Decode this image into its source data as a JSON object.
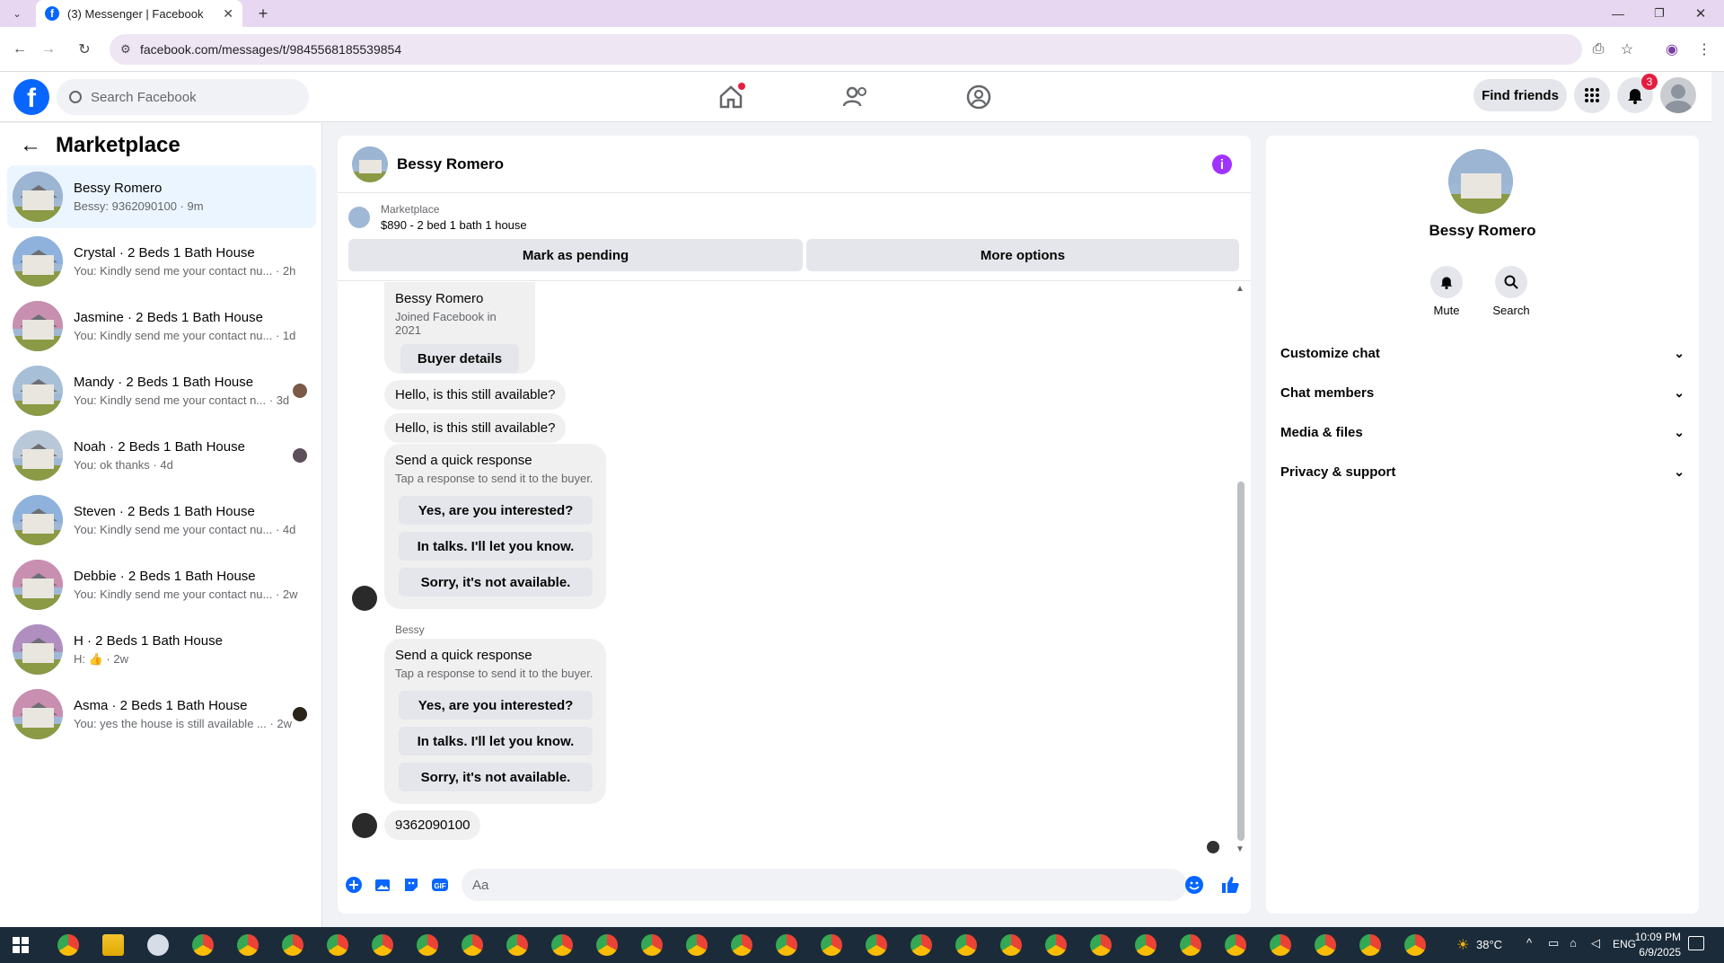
{
  "browser": {
    "tab_title": "(3) Messenger | Facebook",
    "url": "facebook.com/messages/t/9845568185539854",
    "new_tab_label": "+"
  },
  "header": {
    "search_placeholder": "Search Facebook",
    "find_friends": "Find friends",
    "notification_count": "3"
  },
  "sidebar": {
    "title": "Marketplace",
    "conversations": [
      {
        "name": "Bessy Romero",
        "preview": "Bessy: 9362090100 · 9m",
        "active": true
      },
      {
        "name": "Crystal · 2 Beds 1 Bath House",
        "preview": "You: Kindly send me your contact nu... · 2h"
      },
      {
        "name": "Jasmine · 2 Beds 1 Bath House",
        "preview": "You: Kindly send me your contact nu... · 1d"
      },
      {
        "name": "Mandy · 2 Beds 1 Bath House",
        "preview": "You: Kindly send me your contact n... · 3d"
      },
      {
        "name": "Noah · 2 Beds 1 Bath House",
        "preview": "You: ok thanks · 4d"
      },
      {
        "name": "Steven · 2 Beds 1 Bath House",
        "preview": "You: Kindly send me your contact nu... · 4d"
      },
      {
        "name": "Debbie · 2 Beds 1 Bath House",
        "preview": "You: Kindly send me your contact nu... · 2w"
      },
      {
        "name": "H · 2 Beds 1 Bath House",
        "preview": "H: 👍 · 2w"
      },
      {
        "name": "Asma · 2 Beds 1 Bath House",
        "preview": "You: yes the house is still available ... · 2w"
      }
    ]
  },
  "chat": {
    "contact_name": "Bessy Romero",
    "listing_label": "Marketplace",
    "listing_title": "$890 - 2 bed 1 bath 1 house",
    "mark_pending": "Mark as pending",
    "more_options": "More options",
    "profile_card": {
      "name": "Bessy Romero",
      "joined": "Joined Facebook in 2021",
      "button": "Buyer details"
    },
    "messages": [
      "Hello, is this still available?",
      "Hello, is this still available?"
    ],
    "quick_response": {
      "title": "Send a quick response",
      "subtitle": "Tap a response to send it to the buyer.",
      "options": [
        "Yes, are you interested?",
        "In talks. I'll let you know.",
        "Sorry, it's not available."
      ]
    },
    "sender_label": "Bessy",
    "last_message": "9362090100",
    "composer_placeholder": "Aa"
  },
  "details": {
    "name": "Bessy Romero",
    "actions": [
      {
        "label": "Mute"
      },
      {
        "label": "Search"
      }
    ],
    "sections": [
      "Customize chat",
      "Chat members",
      "Media & files",
      "Privacy & support"
    ]
  },
  "taskbar": {
    "temperature": "38°C",
    "language": "ENG",
    "time": "10:09 PM",
    "date": "6/9/2025"
  },
  "colors": {
    "brand": "#0866ff",
    "active_row": "#ebf5ff",
    "badge": "#e41e3f",
    "info": "#a033ff"
  }
}
